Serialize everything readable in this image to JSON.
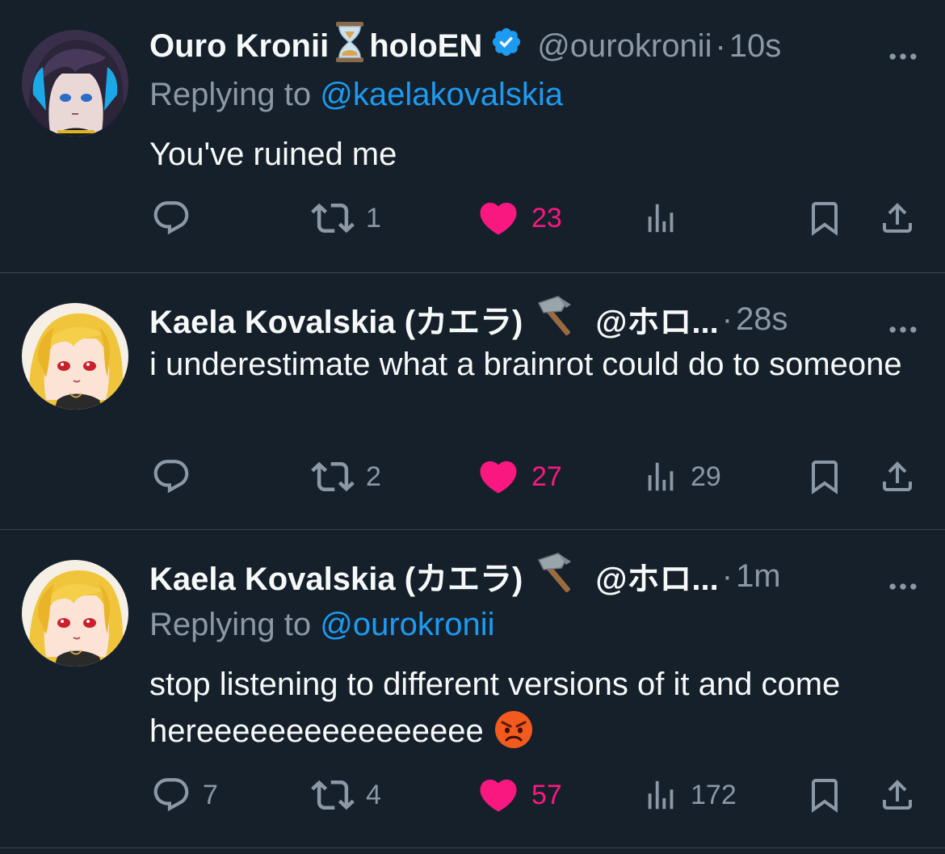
{
  "colors": {
    "background": "#15202b",
    "text": "#f7f9f9",
    "secondary": "#8b98a5",
    "link": "#1d9bf0",
    "like": "#f91880",
    "divider": "#38444d"
  },
  "tweets": [
    {
      "display_name": "Ouro Kronii",
      "name_emoji": "hourglass",
      "name_suffix": "holoEN",
      "verified": true,
      "handle": "@ourokronii",
      "dot": "·",
      "time": "10s",
      "replying_prefix": "Replying to",
      "replying_to": "@kaelakovalskia",
      "text": "You've ruined me",
      "replies": "",
      "retweets": "1",
      "likes": "23",
      "views": ""
    },
    {
      "display_name": "Kaela Kovalskia (カエラ)",
      "name_emoji": "hammer",
      "handle": "@ホロ...",
      "dot": "·",
      "time": "28s",
      "text": "i underestimate what a brainrot could do to someone",
      "replies": "",
      "retweets": "2",
      "likes": "27",
      "views": "29"
    },
    {
      "display_name": "Kaela Kovalskia (カエラ)",
      "name_emoji": "hammer",
      "handle": "@ホロ...",
      "dot": "·",
      "time": "1m",
      "replying_prefix": "Replying to",
      "replying_to": "@ourokronii",
      "text": "stop listening to different versions of it and come hereeeeeeeeeeeeeeee",
      "text_emoji": "angry-face",
      "replies": "7",
      "retweets": "4",
      "likes": "57",
      "views": "172"
    }
  ]
}
